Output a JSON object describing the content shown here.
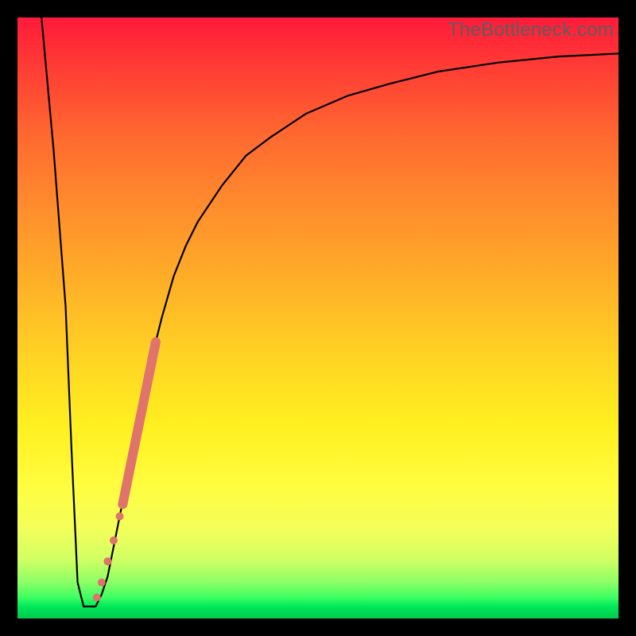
{
  "watermark": "TheBottleneck.com",
  "chart_data": {
    "type": "line",
    "title": "",
    "xlabel": "",
    "ylabel": "",
    "xlim": [
      0,
      100
    ],
    "ylim": [
      0,
      100
    ],
    "grid": false,
    "background_gradient": {
      "top_color": "#ff1a3a",
      "mid_color": "#ffd224",
      "bottom_color": "#00c94f"
    },
    "series": [
      {
        "name": "bottleneck-curve",
        "color": "#000000",
        "x": [
          4,
          6,
          8,
          9,
          10,
          11,
          12,
          13,
          14,
          15,
          16,
          18,
          20,
          22,
          24,
          26,
          28,
          30,
          34,
          38,
          42,
          48,
          55,
          62,
          70,
          80,
          90,
          100
        ],
        "y": [
          100,
          78,
          52,
          28,
          6,
          2,
          2,
          2,
          4,
          7,
          12,
          22,
          32,
          42,
          50,
          57,
          62,
          66,
          72,
          77,
          80,
          84,
          87,
          89,
          91,
          92.5,
          93.5,
          94
        ]
      }
    ],
    "highlight_markers": {
      "name": "highlighted-segment",
      "color": "#e0736b",
      "points": [
        {
          "x": 13.2,
          "y": 3.5,
          "r": 5
        },
        {
          "x": 14.0,
          "y": 6.0,
          "r": 5
        },
        {
          "x": 15.0,
          "y": 9.5,
          "r": 5
        },
        {
          "x": 16.0,
          "y": 13.0,
          "r": 5
        },
        {
          "x": 17.0,
          "y": 17.0,
          "r": 5
        }
      ],
      "thick_segment": {
        "x0": 17.5,
        "y0": 19,
        "x1": 23.0,
        "y1": 46,
        "width": 12
      }
    }
  }
}
